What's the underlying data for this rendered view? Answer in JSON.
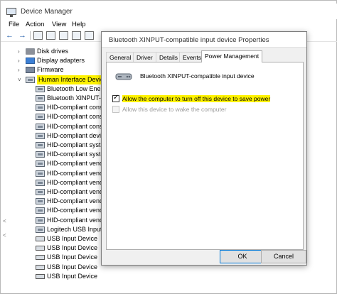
{
  "window": {
    "title": "Device Manager"
  },
  "menu": [
    "File",
    "Action",
    "View",
    "Help"
  ],
  "tree": {
    "items": [
      {
        "label": "Disk drives",
        "icon": "disk-drive-icon",
        "toggle": ">",
        "level": 1
      },
      {
        "label": "Display adapters",
        "icon": "display-adapter-icon",
        "toggle": ">",
        "level": 1
      },
      {
        "label": "Firmware",
        "icon": "firmware-icon",
        "toggle": ">",
        "level": 1
      },
      {
        "label": "Human Interface Devices",
        "icon": "hid-category-icon",
        "toggle": "v",
        "level": 1,
        "selected": true
      },
      {
        "label": "Bluetooth Low Energy",
        "icon": "hid-device-icon",
        "level": 2
      },
      {
        "label": "Bluetooth XINPUT-",
        "icon": "hid-device-icon",
        "level": 2
      },
      {
        "label": "HID-compliant consu",
        "icon": "hid-device-icon",
        "level": 2
      },
      {
        "label": "HID-compliant consu",
        "icon": "hid-device-icon",
        "level": 2
      },
      {
        "label": "HID-compliant consu",
        "icon": "hid-device-icon",
        "level": 2
      },
      {
        "label": "HID-compliant device",
        "icon": "hid-device-icon",
        "level": 2
      },
      {
        "label": "HID-compliant syster",
        "icon": "hid-device-icon",
        "level": 2
      },
      {
        "label": "HID-compliant syster",
        "icon": "hid-device-icon",
        "level": 2
      },
      {
        "label": "HID-compliant vendo",
        "icon": "hid-device-icon",
        "level": 2
      },
      {
        "label": "HID-compliant vendo",
        "icon": "hid-device-icon",
        "level": 2
      },
      {
        "label": "HID-compliant vendo",
        "icon": "hid-device-icon",
        "level": 2
      },
      {
        "label": "HID-compliant vendo",
        "icon": "hid-device-icon",
        "level": 2
      },
      {
        "label": "HID-compliant vendo",
        "icon": "hid-device-icon",
        "level": 2
      },
      {
        "label": "HID-compliant vendo",
        "icon": "hid-device-icon",
        "level": 2
      },
      {
        "label": "HID-compliant vendo",
        "icon": "hid-device-icon",
        "level": 2
      },
      {
        "label": "Logitech USB Input D",
        "icon": "hid-device-icon",
        "level": 2
      },
      {
        "label": "USB Input Device",
        "icon": "usb-device-icon",
        "level": 2
      },
      {
        "label": "USB Input Device",
        "icon": "usb-device-icon",
        "level": 2
      },
      {
        "label": "USB Input Device",
        "icon": "usb-device-icon",
        "level": 2
      },
      {
        "label": "USB Input Device",
        "icon": "usb-device-icon",
        "level": 2
      },
      {
        "label": "USB Input Device",
        "icon": "usb-device-icon",
        "level": 2
      }
    ]
  },
  "dialog": {
    "title": "Bluetooth XINPUT-compatible input device Properties",
    "tabs": [
      "General",
      "Driver",
      "Details",
      "Events",
      "Power Management"
    ],
    "active_tab": "Power Management",
    "device_name": "Bluetooth XINPUT-compatible input device",
    "option_allow_turn_off": {
      "label": "Allow the computer to turn off this device to save power",
      "checked": true,
      "enabled": true
    },
    "option_allow_wake": {
      "label": "Allow this device to wake the computer",
      "checked": false,
      "enabled": false
    },
    "ok_label": "OK",
    "cancel_label": "Cancel"
  },
  "colors": {
    "highlight": "#fff200",
    "accent": "#0078d7"
  }
}
